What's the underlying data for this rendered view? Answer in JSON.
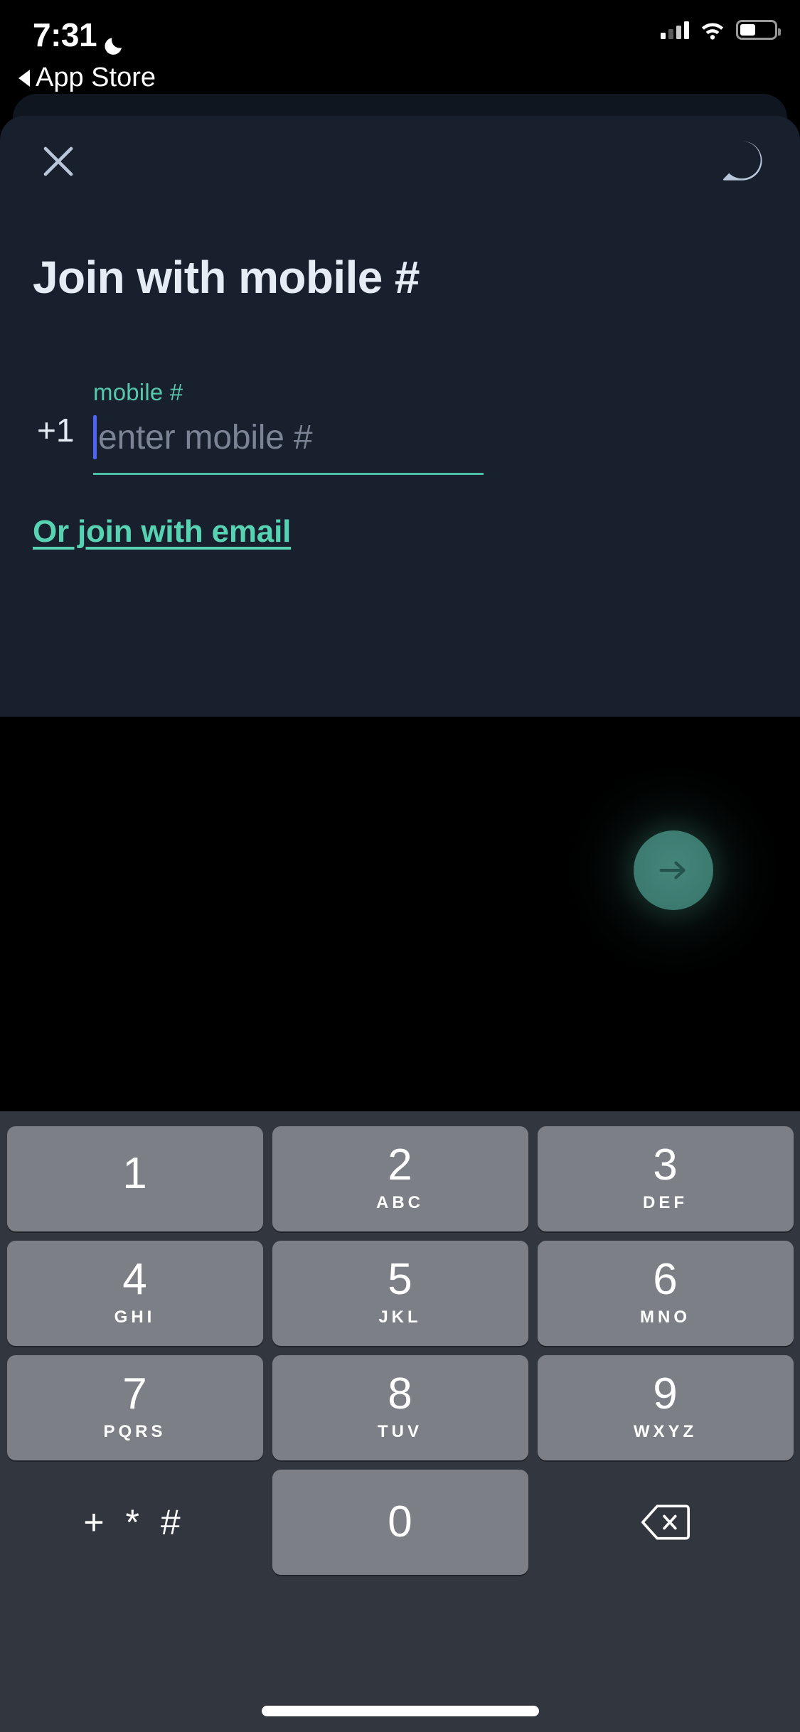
{
  "status_bar": {
    "time": "7:31",
    "moon_icon": "crescent-moon-icon",
    "back_label": "App Store",
    "signal_icon": "cellular-signal-icon",
    "wifi_icon": "wifi-icon",
    "battery_icon": "battery-icon"
  },
  "nav": {
    "close_icon": "close-x-icon",
    "help_icon": "help-question-bubble-icon"
  },
  "screen": {
    "title": "Join with mobile #",
    "field": {
      "label": "mobile #",
      "country_code": "+1",
      "placeholder": "enter mobile #",
      "value": ""
    },
    "alt_link": "Or join with email",
    "submit": {
      "icon": "arrow-right-icon",
      "label": "continue"
    }
  },
  "keypad": {
    "rows": [
      [
        {
          "num": "1",
          "letters": ""
        },
        {
          "num": "2",
          "letters": "ABC"
        },
        {
          "num": "3",
          "letters": "DEF"
        }
      ],
      [
        {
          "num": "4",
          "letters": "GHI"
        },
        {
          "num": "5",
          "letters": "JKL"
        },
        {
          "num": "6",
          "letters": "MNO"
        }
      ],
      [
        {
          "num": "7",
          "letters": "PQRS"
        },
        {
          "num": "8",
          "letters": "TUV"
        },
        {
          "num": "9",
          "letters": "WXYZ"
        }
      ]
    ],
    "bottom": {
      "symbols": "+ * #",
      "zero": "0",
      "delete_icon": "backspace-delete-icon"
    }
  },
  "colors": {
    "sheet_bg": "#18202e",
    "keypad_bg": "#32363e",
    "key_bg": "#7c8086",
    "accent_teal": "#4cbfa4",
    "label_teal": "#57c8ab",
    "link_teal": "#57d3b3",
    "caret_blue": "#4f63f5",
    "fab_green": "#3c7a70",
    "title_text": "#e6ecf5",
    "placeholder_text": "#7b8494"
  },
  "home_indicator": "home-indicator"
}
